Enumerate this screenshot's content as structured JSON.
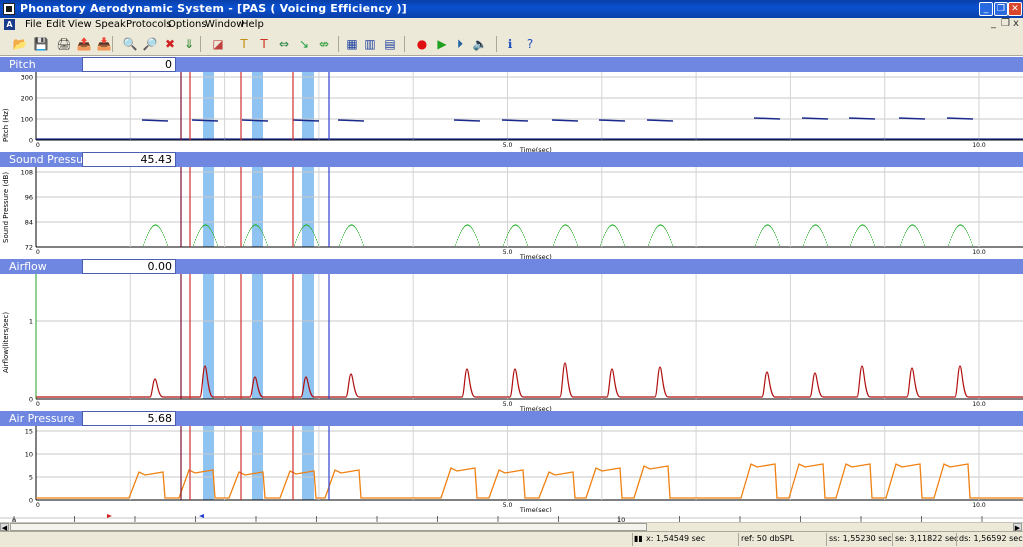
{
  "window": {
    "title": "Phonatory Aerodynamic System - [PAS ( Voicing Efficiency )]",
    "min_label": "_",
    "restore_label": "❐",
    "close_label": "✕"
  },
  "menu": {
    "items": [
      "File",
      "Edit",
      "View",
      "Speak",
      "Protocols",
      "Options",
      "Window",
      "Help"
    ],
    "mdi_min": "_",
    "mdi_restore": "❐",
    "mdi_close": "x"
  },
  "toolbar": {
    "icons": [
      {
        "name": "open-icon",
        "glyph": "📂"
      },
      {
        "name": "save-icon",
        "glyph": "💾"
      },
      {
        "name": "print-icon",
        "glyph": "🖨"
      },
      {
        "name": "export-icon",
        "glyph": "📤"
      },
      {
        "name": "import-icon",
        "glyph": "📥"
      },
      {
        "name": "zoom-out-icon",
        "glyph": "🔍"
      },
      {
        "name": "zoom-in-icon",
        "glyph": "🔎"
      },
      {
        "name": "delete-icon",
        "glyph": "✖"
      },
      {
        "name": "down-arrow-icon",
        "glyph": "⇓"
      },
      {
        "name": "eraser-icon",
        "glyph": "◪"
      },
      {
        "name": "text-marker-icon",
        "glyph": "T"
      },
      {
        "name": "clear-marker-icon",
        "glyph": "T"
      },
      {
        "name": "expand-icon",
        "glyph": "⇔"
      },
      {
        "name": "move-down-icon",
        "glyph": "↘"
      },
      {
        "name": "contract-icon",
        "glyph": "⇎"
      },
      {
        "name": "layout-1-icon",
        "glyph": "▦"
      },
      {
        "name": "layout-2-icon",
        "glyph": "▥"
      },
      {
        "name": "layout-3-icon",
        "glyph": "▤"
      },
      {
        "name": "record-icon",
        "glyph": "●"
      },
      {
        "name": "play-icon",
        "glyph": "▶"
      },
      {
        "name": "play-selection-icon",
        "glyph": "⏵"
      },
      {
        "name": "speaker-icon",
        "glyph": "🔈"
      },
      {
        "name": "info-icon",
        "glyph": "ℹ"
      },
      {
        "name": "help-icon",
        "glyph": "?"
      }
    ]
  },
  "colors": {
    "panel_header": "#6f87e0",
    "selection": "#8fc3f2",
    "pitch": "#1a2a8c",
    "sound_pressure": "#22b022",
    "airflow": "#b01010",
    "air_pressure": "#f08010",
    "marker_dark": "#7a1030",
    "marker_red": "#d03030",
    "marker_blue": "#3040d0"
  },
  "panels": [
    {
      "title": "Pitch",
      "value": "0",
      "ylabel": "Pitch (Hz)",
      "yticks": [
        "300",
        "200",
        "100",
        "0"
      ],
      "xticks": [
        "0",
        "5.0",
        "10.0"
      ],
      "xlabel": "Time(sec)"
    },
    {
      "title": "Sound Pressure",
      "value": "45.43",
      "ylabel": "Sound Pressure (dB)",
      "yticks": [
        "108",
        "96",
        "84",
        "72"
      ],
      "xticks": [
        "0",
        "5.0",
        "10.0"
      ],
      "xlabel": "Time(sec)"
    },
    {
      "title": "Airflow",
      "value": "0.00",
      "ylabel": "Airflow(liters/sec)",
      "yticks": [
        "1",
        "0"
      ],
      "xticks": [
        "0",
        "5.0",
        "10.0"
      ],
      "xlabel": "Time(sec)"
    },
    {
      "title": "Air Pressure",
      "value": "5.68",
      "ylabel": "",
      "yticks": [
        "15",
        "10",
        "5",
        "0"
      ],
      "xticks": [
        "0",
        "5.0",
        "10.0"
      ],
      "xlabel": "Time(sec)"
    }
  ],
  "ruler": {
    "labels": [
      "0",
      "10"
    ]
  },
  "status": {
    "x": "x:  1,54549 sec",
    "ref": "ref:  50 dbSPL",
    "ss": "ss:  1,55230 sec",
    "se": "se:  3,11822 sec",
    "ds": "ds:  1,56592 sec"
  }
}
